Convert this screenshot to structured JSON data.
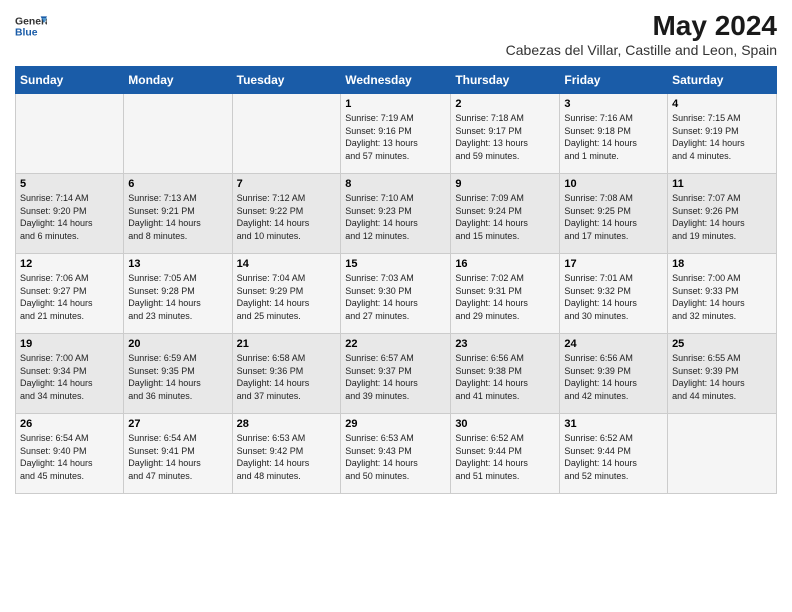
{
  "header": {
    "logo_line1": "General",
    "logo_line2": "Blue",
    "title": "May 2024",
    "subtitle": "Cabezas del Villar, Castille and Leon, Spain"
  },
  "columns": [
    "Sunday",
    "Monday",
    "Tuesday",
    "Wednesday",
    "Thursday",
    "Friday",
    "Saturday"
  ],
  "weeks": [
    [
      {
        "day": "",
        "info": ""
      },
      {
        "day": "",
        "info": ""
      },
      {
        "day": "",
        "info": ""
      },
      {
        "day": "1",
        "info": "Sunrise: 7:19 AM\nSunset: 9:16 PM\nDaylight: 13 hours\nand 57 minutes."
      },
      {
        "day": "2",
        "info": "Sunrise: 7:18 AM\nSunset: 9:17 PM\nDaylight: 13 hours\nand 59 minutes."
      },
      {
        "day": "3",
        "info": "Sunrise: 7:16 AM\nSunset: 9:18 PM\nDaylight: 14 hours\nand 1 minute."
      },
      {
        "day": "4",
        "info": "Sunrise: 7:15 AM\nSunset: 9:19 PM\nDaylight: 14 hours\nand 4 minutes."
      }
    ],
    [
      {
        "day": "5",
        "info": "Sunrise: 7:14 AM\nSunset: 9:20 PM\nDaylight: 14 hours\nand 6 minutes."
      },
      {
        "day": "6",
        "info": "Sunrise: 7:13 AM\nSunset: 9:21 PM\nDaylight: 14 hours\nand 8 minutes."
      },
      {
        "day": "7",
        "info": "Sunrise: 7:12 AM\nSunset: 9:22 PM\nDaylight: 14 hours\nand 10 minutes."
      },
      {
        "day": "8",
        "info": "Sunrise: 7:10 AM\nSunset: 9:23 PM\nDaylight: 14 hours\nand 12 minutes."
      },
      {
        "day": "9",
        "info": "Sunrise: 7:09 AM\nSunset: 9:24 PM\nDaylight: 14 hours\nand 15 minutes."
      },
      {
        "day": "10",
        "info": "Sunrise: 7:08 AM\nSunset: 9:25 PM\nDaylight: 14 hours\nand 17 minutes."
      },
      {
        "day": "11",
        "info": "Sunrise: 7:07 AM\nSunset: 9:26 PM\nDaylight: 14 hours\nand 19 minutes."
      }
    ],
    [
      {
        "day": "12",
        "info": "Sunrise: 7:06 AM\nSunset: 9:27 PM\nDaylight: 14 hours\nand 21 minutes."
      },
      {
        "day": "13",
        "info": "Sunrise: 7:05 AM\nSunset: 9:28 PM\nDaylight: 14 hours\nand 23 minutes."
      },
      {
        "day": "14",
        "info": "Sunrise: 7:04 AM\nSunset: 9:29 PM\nDaylight: 14 hours\nand 25 minutes."
      },
      {
        "day": "15",
        "info": "Sunrise: 7:03 AM\nSunset: 9:30 PM\nDaylight: 14 hours\nand 27 minutes."
      },
      {
        "day": "16",
        "info": "Sunrise: 7:02 AM\nSunset: 9:31 PM\nDaylight: 14 hours\nand 29 minutes."
      },
      {
        "day": "17",
        "info": "Sunrise: 7:01 AM\nSunset: 9:32 PM\nDaylight: 14 hours\nand 30 minutes."
      },
      {
        "day": "18",
        "info": "Sunrise: 7:00 AM\nSunset: 9:33 PM\nDaylight: 14 hours\nand 32 minutes."
      }
    ],
    [
      {
        "day": "19",
        "info": "Sunrise: 7:00 AM\nSunset: 9:34 PM\nDaylight: 14 hours\nand 34 minutes."
      },
      {
        "day": "20",
        "info": "Sunrise: 6:59 AM\nSunset: 9:35 PM\nDaylight: 14 hours\nand 36 minutes."
      },
      {
        "day": "21",
        "info": "Sunrise: 6:58 AM\nSunset: 9:36 PM\nDaylight: 14 hours\nand 37 minutes."
      },
      {
        "day": "22",
        "info": "Sunrise: 6:57 AM\nSunset: 9:37 PM\nDaylight: 14 hours\nand 39 minutes."
      },
      {
        "day": "23",
        "info": "Sunrise: 6:56 AM\nSunset: 9:38 PM\nDaylight: 14 hours\nand 41 minutes."
      },
      {
        "day": "24",
        "info": "Sunrise: 6:56 AM\nSunset: 9:39 PM\nDaylight: 14 hours\nand 42 minutes."
      },
      {
        "day": "25",
        "info": "Sunrise: 6:55 AM\nSunset: 9:39 PM\nDaylight: 14 hours\nand 44 minutes."
      }
    ],
    [
      {
        "day": "26",
        "info": "Sunrise: 6:54 AM\nSunset: 9:40 PM\nDaylight: 14 hours\nand 45 minutes."
      },
      {
        "day": "27",
        "info": "Sunrise: 6:54 AM\nSunset: 9:41 PM\nDaylight: 14 hours\nand 47 minutes."
      },
      {
        "day": "28",
        "info": "Sunrise: 6:53 AM\nSunset: 9:42 PM\nDaylight: 14 hours\nand 48 minutes."
      },
      {
        "day": "29",
        "info": "Sunrise: 6:53 AM\nSunset: 9:43 PM\nDaylight: 14 hours\nand 50 minutes."
      },
      {
        "day": "30",
        "info": "Sunrise: 6:52 AM\nSunset: 9:44 PM\nDaylight: 14 hours\nand 51 minutes."
      },
      {
        "day": "31",
        "info": "Sunrise: 6:52 AM\nSunset: 9:44 PM\nDaylight: 14 hours\nand 52 minutes."
      },
      {
        "day": "",
        "info": ""
      }
    ]
  ]
}
